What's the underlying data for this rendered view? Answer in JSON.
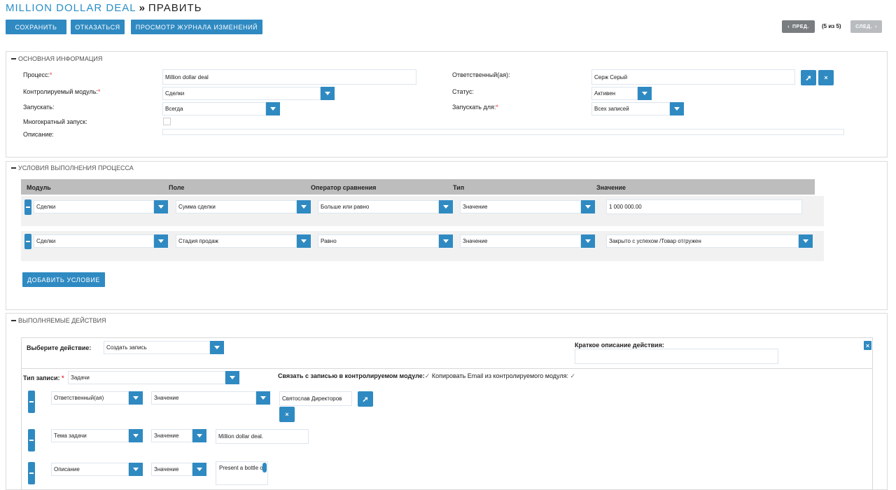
{
  "header": {
    "app_title": "MILLION DOLLAR DEAL",
    "separator": "»",
    "action_title": "ПРАВИТЬ"
  },
  "toolbar": {
    "save_label": "СОХРАНИТЬ",
    "cancel_label": "ОТКАЗАТЬСЯ",
    "changelog_label": "ПРОСМОТР ЖУРНАЛА ИЗМЕНЕНИЙ",
    "prev_label": "ПРЕД.",
    "next_label": "СЛЕД.",
    "page_count": "(5 из 5)"
  },
  "basic": {
    "section_title": "ОСНОВНАЯ ИНФОРМАЦИЯ",
    "process_label": "Процесс:",
    "process_value": "Million dollar deal",
    "module_label": "Контролируемый модуль:",
    "module_value": "Сделки",
    "run_label": "Запускать:",
    "run_value": "Всегда",
    "multi_label": "Многократный запуск:",
    "desc_label": "Описание:",
    "assigned_label": "Ответственный(ая):",
    "assigned_value": "Серж Серый",
    "status_label": "Статус:",
    "status_value": "Активен",
    "run_for_label": "Запускать для:",
    "run_for_value": "Всех записей",
    "required_mark": "*"
  },
  "conditions": {
    "section_title": "УСЛОВИЯ ВЫПОЛНЕНИЯ ПРОЦЕССА",
    "headers": [
      "Модуль",
      "Поле",
      "Оператор сравнения",
      "Тип",
      "Значение"
    ],
    "rows": [
      {
        "module": "Сделки",
        "field": "Сумма сделки",
        "operator": "Больше или равно",
        "type": "Значение",
        "value": "1 000 000.00"
      },
      {
        "module": "Сделки",
        "field": "Стадия продаж",
        "operator": "Равно",
        "type": "Значение",
        "value": "Закрыто с успехом /Товар отгружен"
      }
    ],
    "add_label": "ДОБАВИТЬ УСЛОВИЕ"
  },
  "actions": {
    "section_title": "ВЫПОЛНЯЕМЫЕ ДЕЙСТВИЯ",
    "choose_label": "Выберите действие:",
    "choose_value": "Создать запись",
    "short_desc_label": "Краткое описание действия:",
    "short_desc_value": "",
    "record_type_label": "Тип записи:",
    "record_type_value": "Задачи",
    "link_label": "Связать с записью в контролируемом модуле:",
    "copy_email_label": "Копировать Email из контролируемого модуля:",
    "check_mark": "✓",
    "rows": [
      {
        "field": "Ответственный(ая)",
        "type": "Значение",
        "value": "Святослав Директоров"
      },
      {
        "field": "Тема задачи",
        "type": "Значение",
        "value": "Million dollar deal."
      },
      {
        "field": "Описание",
        "type": "Значение",
        "value": "Present a bottle of"
      }
    ]
  },
  "icons": {
    "select": "arrow-select-icon",
    "clear": "close-icon",
    "remove": "close-box-icon"
  },
  "colors": {
    "accent": "#2f8ac2",
    "title": "#2a8fc7",
    "table_header": "#bdbdbd",
    "row_bg": "#f1f1f1"
  }
}
